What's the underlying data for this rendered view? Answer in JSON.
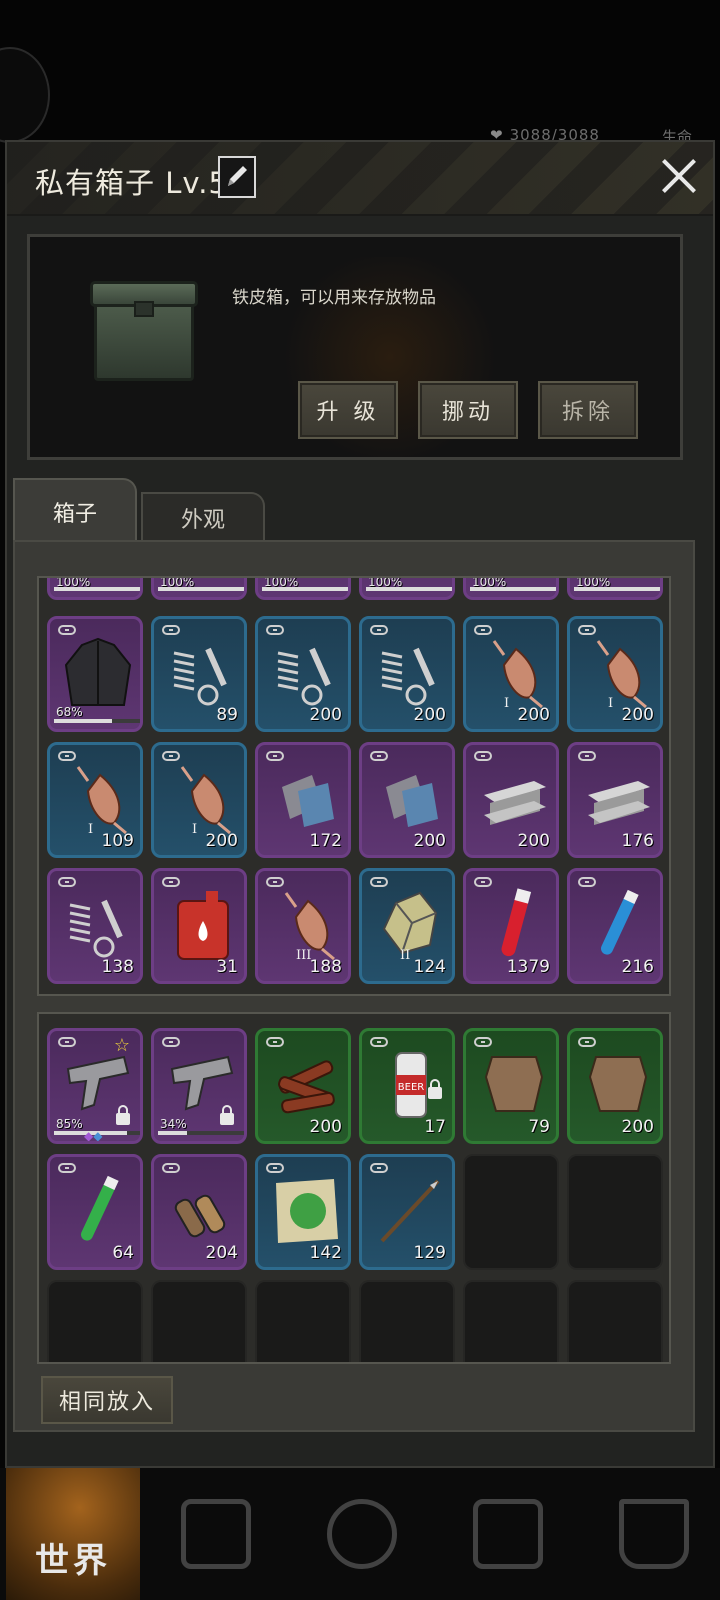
{
  "status_peek": {
    "hp": "3088/3088",
    "right_label": "生命"
  },
  "panel": {
    "title": "私有箱子 Lv.5",
    "description": "铁皮箱，可以用来存放物品",
    "buttons": {
      "upgrade": "升 级",
      "move": "挪动",
      "dismantle": "拆除"
    }
  },
  "tabs": [
    {
      "label": "箱子",
      "active": true
    },
    {
      "label": "外观",
      "active": false
    }
  ],
  "box_grid": {
    "partial_row_percentages": [
      "100%",
      "100%",
      "100%",
      "100%",
      "100%",
      "100%"
    ],
    "items": [
      {
        "item": "jacket-icon",
        "rarity": "purple",
        "durability": "68%",
        "count": ""
      },
      {
        "item": "spring-bolt-icon",
        "rarity": "blue",
        "count": "89"
      },
      {
        "item": "spring-bolt-icon",
        "rarity": "blue",
        "count": "200"
      },
      {
        "item": "spring-bolt-icon",
        "rarity": "blue",
        "count": "200"
      },
      {
        "item": "copper-wire-icon",
        "rarity": "blue",
        "tier": "I",
        "count": "200"
      },
      {
        "item": "copper-wire-icon",
        "rarity": "blue",
        "tier": "I",
        "count": "200"
      },
      {
        "item": "copper-wire-icon",
        "rarity": "blue",
        "tier": "I",
        "count": "109"
      },
      {
        "item": "copper-wire-icon",
        "rarity": "blue",
        "tier": "I",
        "count": "200"
      },
      {
        "item": "cloth-icon",
        "rarity": "purple",
        "count": "172"
      },
      {
        "item": "cloth-icon",
        "rarity": "purple",
        "count": "200"
      },
      {
        "item": "steel-beam-icon",
        "rarity": "purple",
        "count": "200"
      },
      {
        "item": "steel-beam-icon",
        "rarity": "purple",
        "count": "176"
      },
      {
        "item": "spring-bolt-icon",
        "rarity": "purple",
        "count": "138"
      },
      {
        "item": "fuel-can-icon",
        "rarity": "purple",
        "count": "31"
      },
      {
        "item": "copper-wire-icon",
        "rarity": "purple",
        "tier": "III",
        "count": "188"
      },
      {
        "item": "ore-icon",
        "rarity": "blue",
        "tier": "II",
        "count": "124"
      },
      {
        "item": "red-tube-icon",
        "rarity": "purple",
        "count": "1379"
      },
      {
        "item": "blue-tube-icon",
        "rarity": "purple",
        "count": "216"
      }
    ]
  },
  "bag_grid": {
    "items": [
      {
        "item": "pistol-icon",
        "rarity": "purple",
        "durability": "85%",
        "starred": true,
        "locked": true,
        "count": ""
      },
      {
        "item": "pistol-icon",
        "rarity": "purple",
        "durability": "34%",
        "locked": true,
        "count": ""
      },
      {
        "item": "firewood-icon",
        "rarity": "green",
        "count": "200"
      },
      {
        "item": "beer-can-icon",
        "rarity": "green",
        "locked": true,
        "count": "17",
        "can_label": "BEER"
      },
      {
        "item": "hide-icon",
        "rarity": "green",
        "count": "79"
      },
      {
        "item": "hide-icon",
        "rarity": "green",
        "count": "200"
      },
      {
        "item": "green-tube-icon",
        "rarity": "purple",
        "count": "64"
      },
      {
        "item": "bullets-icon",
        "rarity": "purple",
        "count": "204"
      },
      {
        "item": "herb-paper-icon",
        "rarity": "blue",
        "count": "142"
      },
      {
        "item": "spear-icon",
        "rarity": "blue",
        "count": "129"
      }
    ]
  },
  "same_put_button": "相同放入",
  "bottom_nav": {
    "world_label": "世界"
  }
}
